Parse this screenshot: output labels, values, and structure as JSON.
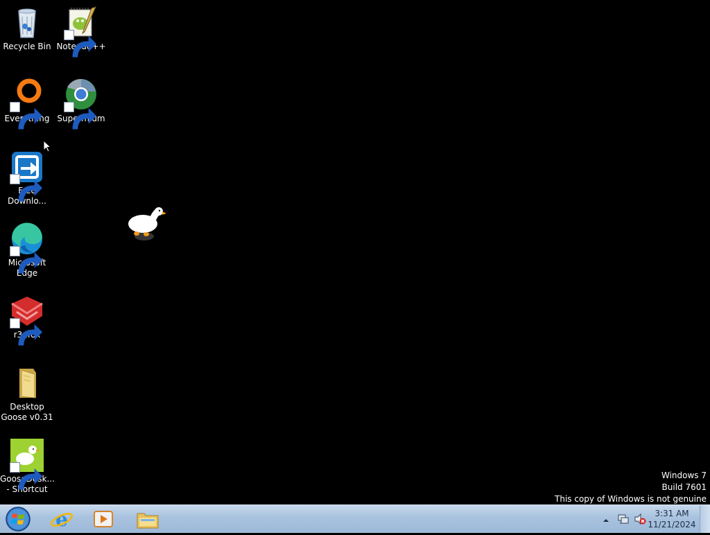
{
  "desktop": {
    "icons": [
      {
        "label": "Recycle Bin",
        "name": "recycle-bin-icon"
      },
      {
        "label": "Notepad++",
        "name": "notepad-plus-plus-icon"
      },
      {
        "label": "Everything",
        "name": "everything-search-icon"
      },
      {
        "label": "Supermium",
        "name": "supermium-browser-icon"
      },
      {
        "label": "Free\nDownlo...",
        "name": "free-download-manager-icon"
      },
      {
        "label": "Microsoft\nEdge",
        "name": "microsoft-edge-icon"
      },
      {
        "label": "r3dfox",
        "name": "r3dfox-browser-icon"
      },
      {
        "label": "Desktop\nGoose v0.31",
        "name": "folder-icon"
      },
      {
        "label": "GooseDesk...\n- Shortcut",
        "name": "goose-desktop-icon"
      }
    ]
  },
  "watermark": {
    "line1": "Windows 7",
    "line2": "Build 7601",
    "line3": "This copy of Windows is not genuine"
  },
  "taskbar": {
    "pinned": [
      {
        "name": "internet-explorer-icon"
      },
      {
        "name": "media-player-icon"
      },
      {
        "name": "file-explorer-icon"
      }
    ],
    "clock": {
      "time": "3:31 AM",
      "date": "11/21/2024"
    }
  },
  "colors": {
    "desktop_bg": "#000000",
    "taskbar": "#a8c2de"
  }
}
